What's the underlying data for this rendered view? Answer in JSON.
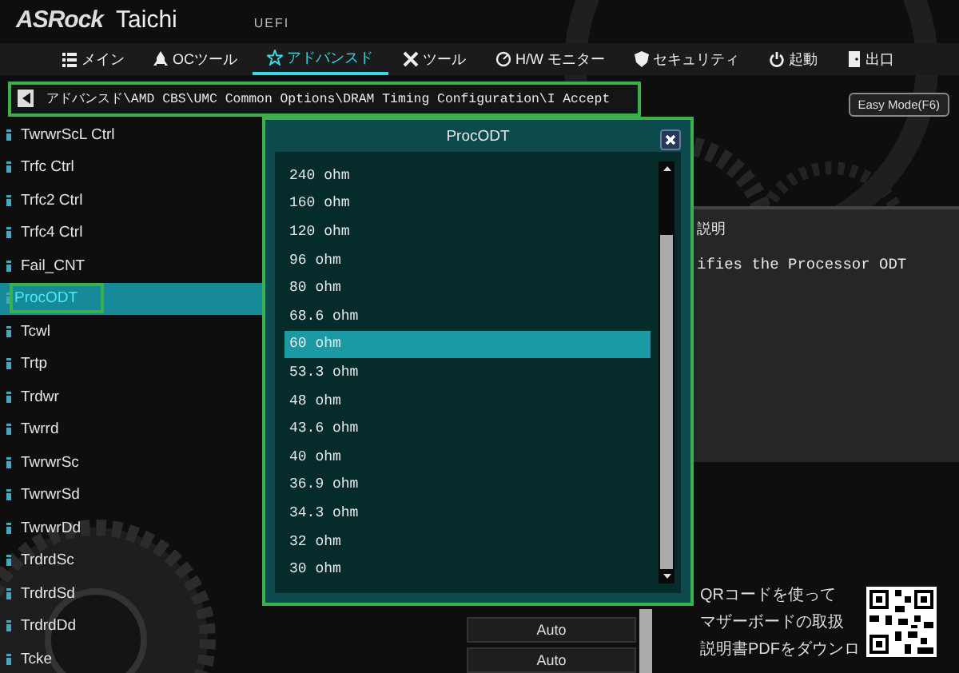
{
  "header": {
    "logo": "ASRock",
    "model": "Taichi",
    "firmware": "UEFI"
  },
  "tabs": [
    {
      "label": "メイン",
      "selected": false
    },
    {
      "label": "OCツール",
      "selected": false
    },
    {
      "label": "アドバンスド",
      "selected": true
    },
    {
      "label": "ツール",
      "selected": false
    },
    {
      "label": "H/W モニター",
      "selected": false
    },
    {
      "label": "セキュリティ",
      "selected": false
    },
    {
      "label": "起動",
      "selected": false
    },
    {
      "label": "出口",
      "selected": false
    }
  ],
  "breadcrumb": "アドバンスド\\AMD CBS\\UMC Common Options\\DRAM Timing Configuration\\I Accept",
  "easy_mode_button": "Easy Mode(F6)",
  "settings": [
    {
      "label": "TwrwrScL Ctrl",
      "selected": false
    },
    {
      "label": "Trfc Ctrl",
      "selected": false
    },
    {
      "label": "Trfc2 Ctrl",
      "selected": false
    },
    {
      "label": "Trfc4 Ctrl",
      "selected": false
    },
    {
      "label": "Fail_CNT",
      "selected": false
    },
    {
      "label": "ProcODT",
      "selected": true
    },
    {
      "label": "Tcwl",
      "selected": false
    },
    {
      "label": "Trtp",
      "selected": false
    },
    {
      "label": "Trdwr",
      "selected": false
    },
    {
      "label": "Twrrd",
      "selected": false
    },
    {
      "label": "TwrwrSc",
      "selected": false
    },
    {
      "label": "TwrwrSd",
      "selected": false
    },
    {
      "label": "TwrwrDd",
      "selected": false
    },
    {
      "label": "TrdrdSc",
      "selected": false
    },
    {
      "label": "TrdrdSd",
      "selected": false
    },
    {
      "label": "TrdrdDd",
      "selected": false
    },
    {
      "label": "Tcke",
      "selected": false
    }
  ],
  "value_buttons": [
    "Auto",
    "Auto"
  ],
  "popup": {
    "title": "ProcODT",
    "options": [
      {
        "label": "240 ohm",
        "selected": false
      },
      {
        "label": "160 ohm",
        "selected": false
      },
      {
        "label": "120 ohm",
        "selected": false
      },
      {
        "label": "96 ohm",
        "selected": false
      },
      {
        "label": "80 ohm",
        "selected": false
      },
      {
        "label": "68.6 ohm",
        "selected": false
      },
      {
        "label": "60 ohm",
        "selected": true
      },
      {
        "label": "53.3 ohm",
        "selected": false
      },
      {
        "label": "48 ohm",
        "selected": false
      },
      {
        "label": "43.6 ohm",
        "selected": false
      },
      {
        "label": "40 ohm",
        "selected": false
      },
      {
        "label": "36.9 ohm",
        "selected": false
      },
      {
        "label": "34.3 ohm",
        "selected": false
      },
      {
        "label": "32 ohm",
        "selected": false
      },
      {
        "label": "30 ohm",
        "selected": false
      }
    ]
  },
  "description": {
    "heading": "説明",
    "text": "ifies the Processor ODT"
  },
  "qr_note": [
    "QRコードを使って",
    "マザーボードの取扱",
    "説明書PDFをダウンロ"
  ]
}
